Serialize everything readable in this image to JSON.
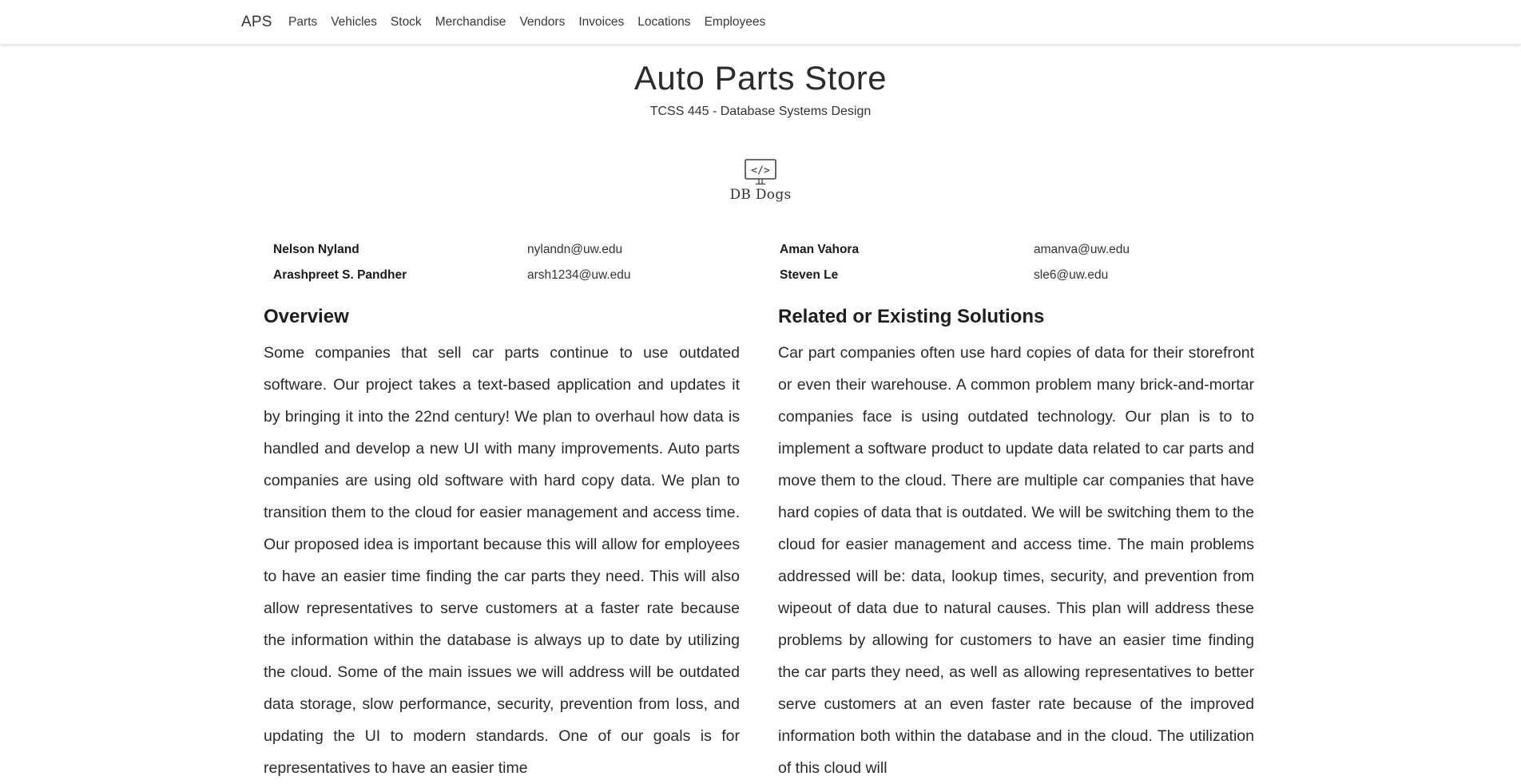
{
  "navbar": {
    "brand": "APS",
    "links": [
      "Parts",
      "Vehicles",
      "Stock",
      "Merchandise",
      "Vendors",
      "Invoices",
      "Locations",
      "Employees"
    ]
  },
  "header": {
    "title": "Auto Parts Store",
    "subtitle": "TCSS 445 - Database Systems Design"
  },
  "logo": {
    "icon": "code-monitor-icon",
    "glyph": "</>",
    "text": "DB Dogs"
  },
  "team": [
    {
      "name_a": "Nelson Nyland",
      "email_a": "nylandn@uw.edu",
      "name_b": "Aman Vahora",
      "email_b": "amanva@uw.edu"
    },
    {
      "name_a": "Arashpreet S. Pandher",
      "email_a": "arsh1234@uw.edu",
      "name_b": "Steven Le",
      "email_b": "sle6@uw.edu"
    }
  ],
  "overview": {
    "heading": "Overview",
    "body": "Some companies that sell car parts continue to use outdated software. Our project takes a text-based application and updates it by bringing it into the 22nd century! We plan to overhaul how data is handled and develop a new UI with many improvements. Auto parts companies are using old software with hard copy data. We plan to transition them to the cloud for easier management and access time. Our proposed idea is important because this will allow for employees to have an easier time finding the car parts they need. This will also allow representatives to serve customers at a faster rate because the information within the database is always up to date by utilizing the cloud. Some of the main issues we will address will be outdated data storage, slow performance, security, prevention from loss, and updating the UI to modern standards. One of our goals is for representatives to have an easier time"
  },
  "related": {
    "heading": "Related or Existing Solutions",
    "body": "Car part companies often use hard copies of data for their storefront or even their warehouse. A common problem many brick-and-mortar companies face is using outdated technology. Our plan is to to implement a software product to update data related to car parts and move them to the cloud. There are multiple car companies that have hard copies of data that is outdated. We will be switching them to the cloud for easier management and access time. The main problems addressed will be: data, lookup times, security, and prevention from wipeout of data due to natural causes. This plan will address these problems by allowing for customers to have an easier time finding the car parts they need, as well as allowing representatives to better serve customers at an even faster rate because of the improved information both within the database and in the cloud. The utilization of this cloud will"
  }
}
